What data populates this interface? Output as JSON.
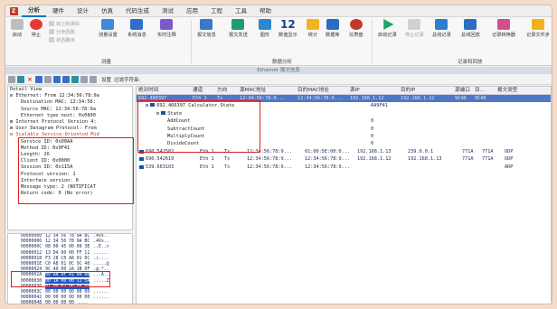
{
  "app": {
    "logo_glyph": "Z",
    "menu": [
      "分析",
      "硬件",
      "设计",
      "仿真",
      "代码生成",
      "测试",
      "应用",
      "工程",
      "工具",
      "帮助"
    ],
    "active_menu": "分析"
  },
  "ribbon": {
    "start_label": "启动",
    "stop_label": "停止",
    "small": [
      "如上轮测出",
      "分步回放",
      "状态路出"
    ],
    "buttons": [
      "测量设置",
      "系统消息",
      "实时注释",
      "报文信息",
      "报文发送",
      "图形",
      "数值显示",
      "统计",
      "数据库",
      "仪表盘",
      "启动记录",
      "停止记录",
      "总线记录",
      "总线回放",
      "记录转换器",
      "记录文件步"
    ],
    "twelve": "12",
    "groups": {
      "test": "测量",
      "data_analysis": "数据分析",
      "record_replay": "记录和回放"
    }
  },
  "window_title": "Ethernet 报文信息",
  "toolbar": {
    "settings_label": "设置",
    "filter_label": "过滤字符串:"
  },
  "detail": {
    "lines": [
      {
        "text": "Detail View",
        "indent": false,
        "hl": false
      },
      {
        "text": "⊟ Ethernet: From 12:34:56:78:9a",
        "indent": false,
        "hl": false
      },
      {
        "text": "Destination MAC: 12:34:56:",
        "indent": true,
        "hl": false
      },
      {
        "text": "Source MAC: 12:34:56:78:9a",
        "indent": true,
        "hl": false
      },
      {
        "text": "Ethernet type next: 0x0800",
        "indent": true,
        "hl": false
      },
      {
        "text": "⊞ Internet Protocol Version 4:",
        "indent": false,
        "hl": false
      },
      {
        "text": "⊞ User Datagram Protocol: From",
        "indent": false,
        "hl": false
      },
      {
        "text": "⊟ Scalable Service-Oriented Mid",
        "indent": false,
        "hl": true
      },
      {
        "text": "Service ID: 0x00AA",
        "indent": true,
        "hl": false
      },
      {
        "text": "Method ID: 0x9F41",
        "indent": true,
        "hl": false
      },
      {
        "text": "Length: 26",
        "indent": true,
        "hl": false
      },
      {
        "text": "Client ID: 0x0000",
        "indent": true,
        "hl": false
      },
      {
        "text": "Session ID: 0x115A",
        "indent": true,
        "hl": false
      },
      {
        "text": "Protocol version: 1",
        "indent": true,
        "hl": false
      },
      {
        "text": "Interface version: 0",
        "indent": true,
        "hl": false
      },
      {
        "text": "Message type: 2 (NOTIFICAT",
        "indent": true,
        "hl": false
      },
      {
        "text": "Return code: 0 (No error)",
        "indent": true,
        "hl": false
      }
    ]
  },
  "hex": {
    "rows": [
      {
        "a": "00000000",
        "b": "12 34 56 78 9A BC",
        "c": ".4Vx..",
        "sel": false
      },
      {
        "a": "00000006",
        "b": "12 34 56 78 9A BC",
        "c": ".4Vx..",
        "sel": false
      },
      {
        "a": "0000000C",
        "b": "08 00 45 00 00 3E",
        "c": "..E..>",
        "sel": false
      },
      {
        "a": "00000012",
        "b": "13 D4 00 00 FF 11",
        "c": "......",
        "sel": false
      },
      {
        "a": "00000018",
        "b": "F3 28 C0 A8 01 0C",
        "c": ".(....",
        "sel": false
      },
      {
        "a": "0000001E",
        "b": "C0 A8 01 0C 9C 40",
        "c": ".....@",
        "sel": false
      },
      {
        "a": "00000024",
        "b": "9C 40 00 2A 1B 0F",
        "c": ".@.*..",
        "sel": false
      },
      {
        "a": "0000002A",
        "b": "00 AA 9F 41 00 00",
        "c": "...A..",
        "sel": true
      },
      {
        "a": "00000030",
        "b": "00 1A 00 00 11 5A",
        "c": ".....Z",
        "sel": true
      },
      {
        "a": "00000036",
        "b": "01 00 02 00 00 00",
        "c": "......",
        "sel": true
      },
      {
        "a": "0000003C",
        "b": "00 00 00 00 00 00",
        "c": "......",
        "sel": false
      },
      {
        "a": "00000042",
        "b": "00 00 00 00 00 00",
        "c": "......",
        "sel": false
      },
      {
        "a": "00000048",
        "b": "00 00 00 00",
        "c": "....",
        "sel": false
      }
    ]
  },
  "packet_list": {
    "columns": [
      "绝对时间",
      "通道",
      "方向",
      "源MAC地址",
      "目的MAC地址",
      "源IP",
      "目的IP",
      "源端口",
      "目...",
      "报文类型"
    ],
    "selected_row": [
      "692.466397",
      "Eth 1",
      "Tx",
      "12:34:56:78:9...",
      "12:34:56:78:9...",
      "192.168.1.12",
      "192.168.1.12",
      "9C40",
      "9C40",
      ""
    ],
    "tree": [
      {
        "label": "692.466397 Calculator.State",
        "value": "AA9F41",
        "level": 0,
        "toggle": "⊟"
      },
      {
        "label": "State",
        "value": "",
        "level": 1,
        "toggle": "⊟"
      },
      {
        "label": "AddCount",
        "value": "0",
        "level": 2,
        "toggle": ""
      },
      {
        "label": "SubtractCount",
        "value": "0",
        "level": 2,
        "toggle": ""
      },
      {
        "label": "MultiplyCount",
        "value": "0",
        "level": 2,
        "toggle": ""
      },
      {
        "label": "DivideCount",
        "value": "0",
        "level": 2,
        "toggle": ""
      }
    ],
    "rows": [
      [
        "690.542582",
        "Eth 1",
        "Tx",
        "12:34:56:78:9...",
        "01:00:5E:00:0...",
        "192.168.1.13",
        "239.0.0.1",
        "771A",
        "771A",
        "UDP"
      ],
      [
        "690.542619",
        "Eth 1",
        "Tx",
        "12:34:56:78:9...",
        "12:34:56:78:9...",
        "192.168.1.12",
        "192.168.1.13",
        "771A",
        "771A",
        "UDP"
      ],
      [
        "539.663103",
        "Eth 1",
        "Tx",
        "12:34:56:78:9...",
        "12:34:56:78:9...",
        "",
        "",
        "",
        "",
        "ARP"
      ]
    ]
  },
  "colors": {
    "accent": "#1a6fc4",
    "highlight_box": "#e21d1d",
    "selection": "#4d78c8"
  }
}
